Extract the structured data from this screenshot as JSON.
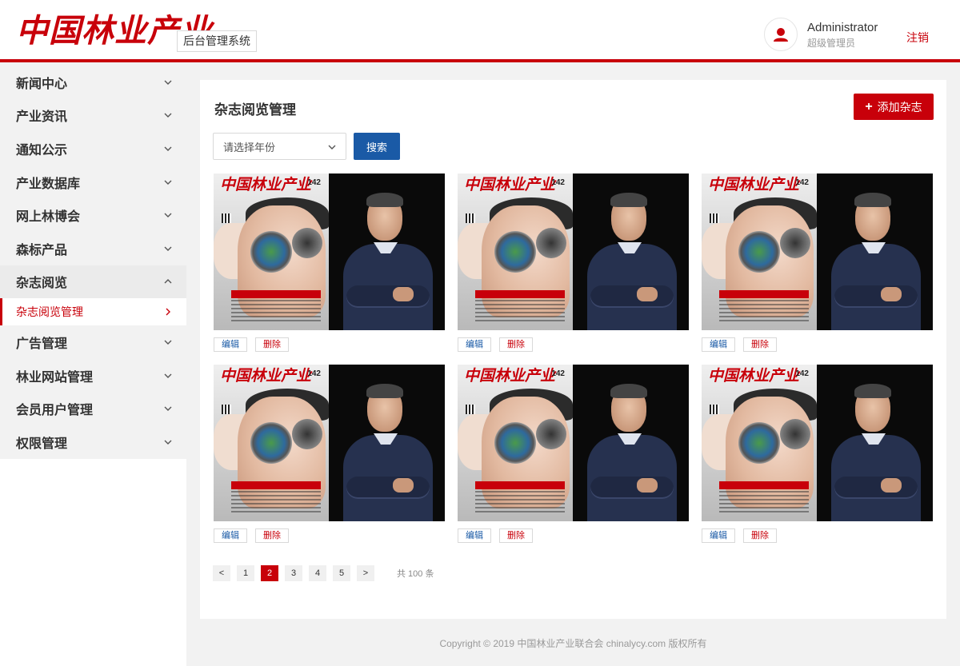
{
  "header": {
    "logo_text": "中国林业产业",
    "system_tag": "后台管理系统",
    "user_name": "Administrator",
    "user_role": "超级管理员",
    "logout_label": "注销"
  },
  "sidebar": {
    "items": [
      {
        "label": "新闻中心",
        "icon": "chevron-down-icon"
      },
      {
        "label": "产业资讯",
        "icon": "chevron-down-icon"
      },
      {
        "label": "通知公示",
        "icon": "chevron-down-icon"
      },
      {
        "label": "产业数据库",
        "icon": "chevron-down-icon"
      },
      {
        "label": "网上林博会",
        "icon": "chevron-down-icon"
      },
      {
        "label": "森标产品",
        "icon": "chevron-down-icon"
      },
      {
        "label": "杂志阅览",
        "icon": "chevron-up-icon",
        "open": true
      },
      {
        "label": "广告管理",
        "icon": "chevron-down-icon"
      },
      {
        "label": "林业网站管理",
        "icon": "chevron-down-icon"
      },
      {
        "label": "会员用户管理",
        "icon": "chevron-down-icon"
      },
      {
        "label": "权限管理",
        "icon": "chevron-down-icon"
      }
    ],
    "sub_item": {
      "label": "杂志阅览管理",
      "icon": "chevron-right-icon"
    }
  },
  "main": {
    "title": "杂志阅览管理",
    "add_button": "添加杂志",
    "year_select_placeholder": "请选择年份",
    "search_button": "搜索",
    "cards": [
      {
        "issue": "142",
        "mag_logo": "中国林业产业",
        "edit": "编辑",
        "delete": "删除"
      },
      {
        "issue": "142",
        "mag_logo": "中国林业产业",
        "edit": "编辑",
        "delete": "删除"
      },
      {
        "issue": "142",
        "mag_logo": "中国林业产业",
        "edit": "编辑",
        "delete": "删除"
      },
      {
        "issue": "142",
        "mag_logo": "中国林业产业",
        "edit": "编辑",
        "delete": "删除"
      },
      {
        "issue": "142",
        "mag_logo": "中国林业产业",
        "edit": "编辑",
        "delete": "删除"
      },
      {
        "issue": "142",
        "mag_logo": "中国林业产业",
        "edit": "编辑",
        "delete": "删除"
      }
    ],
    "pagination": {
      "prev": "<",
      "pages": [
        "1",
        "2",
        "3",
        "4",
        "5"
      ],
      "current": "2",
      "next": ">",
      "total": "共 100 条"
    }
  },
  "footer": {
    "copyright": "Copyright © 2019 中国林业产业联合会 chinalycy.com 版权所有"
  },
  "colors": {
    "brand_red": "#c8000a",
    "search_blue": "#1a5aa6"
  }
}
